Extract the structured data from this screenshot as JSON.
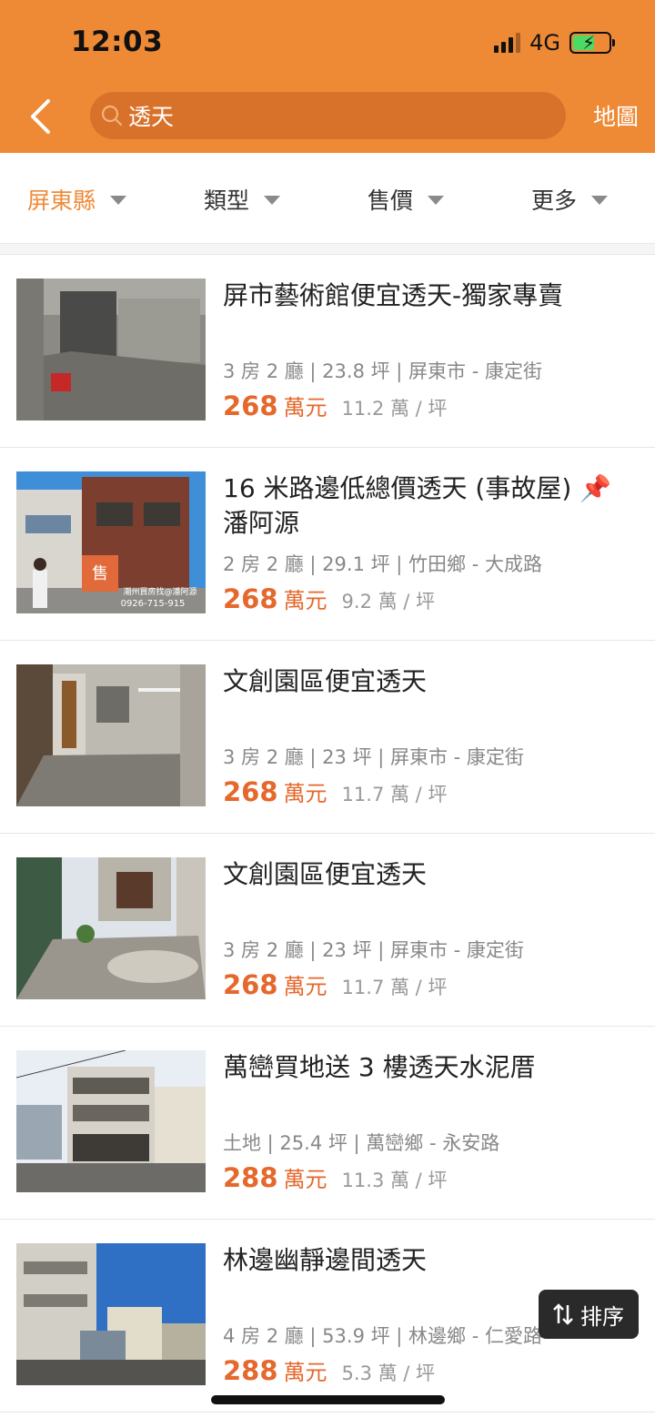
{
  "status_bar": {
    "time": "12:03",
    "network": "4G"
  },
  "header": {
    "search_query": "透天",
    "map_label": "地圖"
  },
  "filters": [
    {
      "label": "屏東縣",
      "active": true
    },
    {
      "label": "類型",
      "active": false
    },
    {
      "label": "售價",
      "active": false
    },
    {
      "label": "更多",
      "active": false
    }
  ],
  "listings": [
    {
      "title": "屏市藝術館便宜透天-獨家專賣",
      "meta": "3 房 2 廳 | 23.8 坪 | 屏東市 - 康定街",
      "price": "268",
      "price_unit": "萬元",
      "unit_price": "11.2 萬 / 坪"
    },
    {
      "title": "16 米路邊低總價透天 (事故屋) 📌 潘阿源",
      "meta": "2 房 2 廳 | 29.1 坪 | 竹田鄉 - 大成路",
      "price": "268",
      "price_unit": "萬元",
      "unit_price": "9.2 萬 / 坪",
      "photo_text": {
        "sign": "售",
        "banner": "潮州買房找@潘阿源",
        "phone": "0926-715-915"
      }
    },
    {
      "title": "文創園區便宜透天",
      "meta": "3 房 2 廳 | 23 坪 | 屏東市 - 康定街",
      "price": "268",
      "price_unit": "萬元",
      "unit_price": "11.7 萬 / 坪"
    },
    {
      "title": "文創園區便宜透天",
      "meta": "3 房 2 廳 | 23 坪 | 屏東市 - 康定街",
      "price": "268",
      "price_unit": "萬元",
      "unit_price": "11.7 萬 / 坪"
    },
    {
      "title": "萬巒買地送 3 樓透天水泥厝",
      "meta": "土地 | 25.4 坪 | 萬巒鄉 - 永安路",
      "price": "288",
      "price_unit": "萬元",
      "unit_price": "11.3 萬 / 坪"
    },
    {
      "title": "林邊幽靜邊間透天",
      "meta": "4 房 2 廳 | 53.9 坪 | 林邊鄉 - 仁愛路",
      "price": "288",
      "price_unit": "萬元",
      "unit_price": "5.3 萬 / 坪"
    }
  ],
  "sort_button": {
    "label": "排序",
    "icon": "sort-arrows-icon"
  },
  "colors": {
    "header": "#ee8a35",
    "search_bg": "#d8722a",
    "accent": "#e5682c",
    "active_filter": "#ef8b3a"
  }
}
